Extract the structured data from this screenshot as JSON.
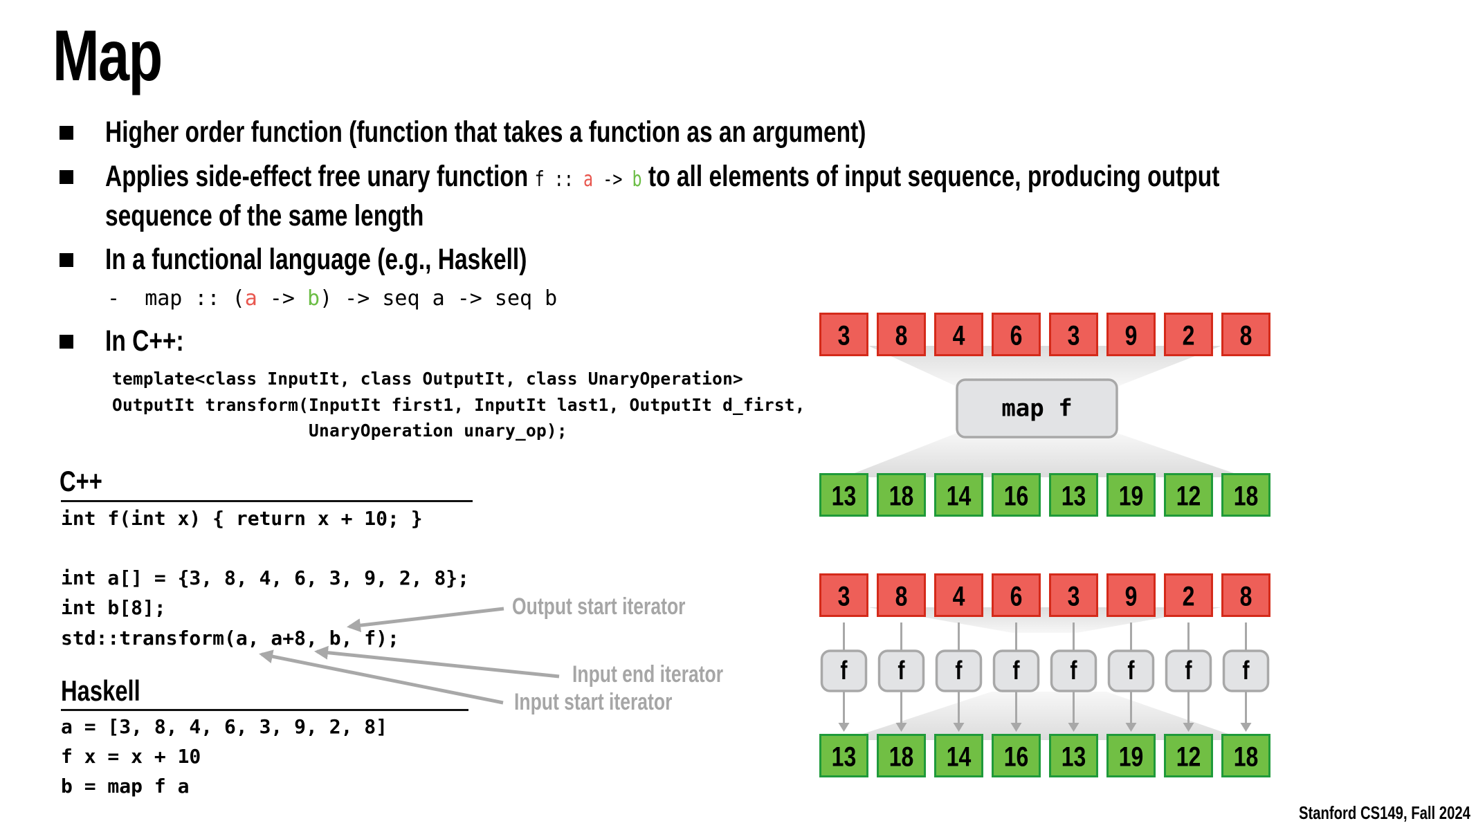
{
  "slide": {
    "title": "Map",
    "footer": "Stanford CS149, Fall 2024"
  },
  "bullets": [
    {
      "text": "Higher order function (function that takes a function as an argument)"
    },
    {
      "pre": "Applies side-effect free unary function ",
      "sig_f": "f",
      "sig_colons": " :: ",
      "sig_a": "a",
      "sig_arrow": " -> ",
      "sig_b": "b",
      "post_line1": " to all elements of input sequence, producing output",
      "line2": "sequence of the same length"
    },
    {
      "text": "In a functional language (e.g., Haskell)",
      "sub_dash": "-",
      "sub_p1": "map :: (",
      "sub_a": "a",
      "sub_p2": " -> ",
      "sub_b": "b",
      "sub_p3": ") -> seq a -> seq b"
    },
    {
      "text": "In C++:",
      "code": [
        "template<class InputIt, class OutputIt, class UnaryOperation>",
        "OutputIt transform(InputIt first1, InputIt last1, OutputIt d_first,",
        "                   UnaryOperation unary_op);"
      ]
    }
  ],
  "cpp_section": {
    "heading": "C++",
    "code": [
      "int f(int x) { return x + 10; }",
      "",
      "int a[] = {3, 8, 4, 6, 3, 9, 2, 8};",
      "int b[8];",
      "std::transform(a, a+8, b, f);"
    ],
    "annotations": {
      "output_start": "Output start iterator",
      "input_end": "Input end iterator",
      "input_start": "Input start iterator"
    }
  },
  "haskell_section": {
    "heading": "Haskell",
    "code": [
      "a = [3, 8, 4, 6, 3, 9, 2, 8]",
      "f x = x + 10",
      "b = map f a"
    ]
  },
  "diagram": {
    "colors": {
      "input_fill": "#ee5f58",
      "input_border": "#d42a1a",
      "output_fill": "#71bf44",
      "output_border": "#1f9a3a",
      "func_fill": "#e2e3e5",
      "func_border": "#a8a8a8",
      "arrow": "#a8a8a8",
      "shadow": "#e6e6e6"
    },
    "input": [
      3,
      8,
      4,
      6,
      3,
      9,
      2,
      8
    ],
    "output": [
      13,
      18,
      14,
      16,
      13,
      19,
      12,
      18
    ],
    "map_label": "map f",
    "f_label": "f"
  }
}
